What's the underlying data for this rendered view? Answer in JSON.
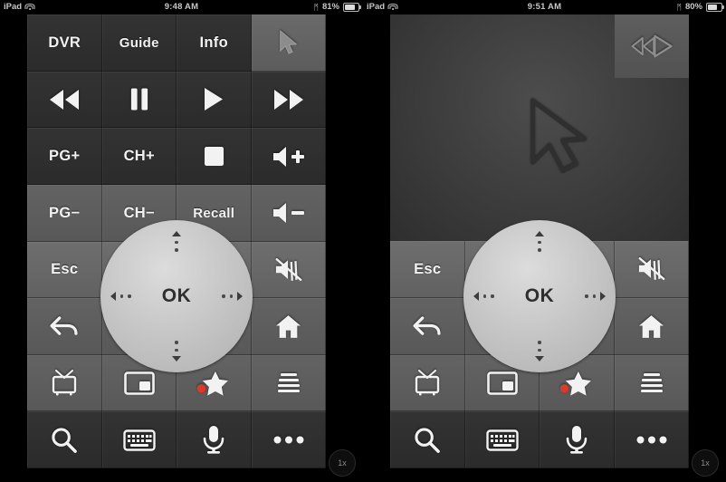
{
  "devices": [
    {
      "id": "left",
      "statusbar": {
        "device": "iPad",
        "wifi_icon": "wifi-icon",
        "time": "9:48 AM",
        "bluetooth_icon": "bluetooth-icon",
        "battery_pct": "81%",
        "battery_icon": "battery-icon",
        "battery_level": 81
      },
      "view": "buttons",
      "zoom_badge": "1x",
      "rows": [
        {
          "keys": [
            {
              "name": "dvr-button",
              "label": "DVR",
              "style": "dark",
              "type": "text"
            },
            {
              "name": "guide-button",
              "label": "Guide",
              "style": "dark",
              "type": "text"
            },
            {
              "name": "info-button",
              "label": "Info",
              "style": "dark",
              "type": "text"
            },
            {
              "name": "cursor-mode-button",
              "label": "",
              "style": "hl",
              "type": "icon",
              "icon": "cursor-arrow-icon"
            }
          ]
        },
        {
          "keys": [
            {
              "name": "rewind-button",
              "label": "",
              "style": "dark",
              "type": "icon",
              "icon": "rewind-icon"
            },
            {
              "name": "pause-button",
              "label": "",
              "style": "dark",
              "type": "icon",
              "icon": "pause-icon"
            },
            {
              "name": "play-button",
              "label": "",
              "style": "dark",
              "type": "icon",
              "icon": "play-icon"
            },
            {
              "name": "fast-forward-button",
              "label": "",
              "style": "dark",
              "type": "icon",
              "icon": "fast-forward-icon"
            }
          ]
        },
        {
          "keys": [
            {
              "name": "page-up-button",
              "label": "PG+",
              "style": "dark",
              "type": "text"
            },
            {
              "name": "channel-up-button",
              "label": "CH+",
              "style": "dark",
              "type": "text"
            },
            {
              "name": "stop-button",
              "label": "",
              "style": "dark",
              "type": "icon",
              "icon": "stop-icon"
            },
            {
              "name": "volume-up-button",
              "label": "",
              "style": "dark",
              "type": "icon",
              "icon": "volume-up-icon"
            }
          ]
        },
        {
          "keys": [
            {
              "name": "page-down-button",
              "label": "PG−",
              "style": "mid",
              "type": "text"
            },
            {
              "name": "channel-down-button",
              "label": "CH−",
              "style": "mid",
              "type": "text"
            },
            {
              "name": "recall-button",
              "label": "Recall",
              "style": "mid",
              "type": "text"
            },
            {
              "name": "volume-down-button",
              "label": "",
              "style": "mid",
              "type": "icon",
              "icon": "volume-down-icon"
            }
          ]
        },
        {
          "keys": [
            {
              "name": "esc-button",
              "label": "Esc",
              "style": "lighter",
              "type": "text"
            },
            {
              "name": "dpad-spacer-a",
              "label": "",
              "style": "lighter",
              "type": "none"
            },
            {
              "name": "dpad-spacer-b",
              "label": "",
              "style": "lighter",
              "type": "none"
            },
            {
              "name": "mute-button",
              "label": "",
              "style": "lighter",
              "type": "icon",
              "icon": "mute-icon"
            }
          ]
        },
        {
          "keys": [
            {
              "name": "back-button",
              "label": "",
              "style": "mid",
              "type": "icon",
              "icon": "back-arrow-icon"
            },
            {
              "name": "dpad-spacer-c",
              "label": "",
              "style": "mid",
              "type": "none"
            },
            {
              "name": "dpad-spacer-d",
              "label": "",
              "style": "mid",
              "type": "none"
            },
            {
              "name": "home-button",
              "label": "",
              "style": "mid",
              "type": "icon",
              "icon": "home-icon"
            }
          ]
        },
        {
          "keys": [
            {
              "name": "live-tv-button",
              "label": "",
              "style": "mid",
              "type": "icon",
              "icon": "tv-icon"
            },
            {
              "name": "picture-in-picture-button",
              "label": "",
              "style": "mid",
              "type": "icon",
              "icon": "pip-icon"
            },
            {
              "name": "record-favorite-button",
              "label": "",
              "style": "mid",
              "type": "icon",
              "icon": "star-record-icon"
            },
            {
              "name": "list-menu-button",
              "label": "",
              "style": "mid",
              "type": "icon",
              "icon": "list-icon"
            }
          ]
        },
        {
          "keys": [
            {
              "name": "search-button",
              "label": "",
              "style": "dark",
              "type": "icon",
              "icon": "search-icon"
            },
            {
              "name": "keyboard-button",
              "label": "",
              "style": "dark",
              "type": "icon",
              "icon": "keyboard-icon"
            },
            {
              "name": "microphone-button",
              "label": "",
              "style": "dark",
              "type": "icon",
              "icon": "microphone-icon"
            },
            {
              "name": "more-options-button",
              "label": "",
              "style": "dark",
              "type": "icon",
              "icon": "ellipsis-icon"
            }
          ]
        }
      ],
      "dpad": {
        "ok_label": "OK",
        "up": "dpad-up",
        "down": "dpad-down",
        "left": "dpad-left",
        "right": "dpad-right"
      }
    },
    {
      "id": "right",
      "statusbar": {
        "device": "iPad",
        "wifi_icon": "wifi-icon",
        "time": "9:51 AM",
        "bluetooth_icon": "bluetooth-icon",
        "battery_pct": "80%",
        "battery_icon": "battery-icon",
        "battery_level": 80
      },
      "view": "trackpad",
      "zoom_badge": "1x",
      "trackpad": {
        "mode_button_icon": "skip-back-play-icon",
        "cursor_icon": "cursor-arrow-outline-icon"
      },
      "rows": [
        {
          "keys": [
            {
              "name": "esc-button",
              "label": "Esc",
              "style": "lighter",
              "type": "text"
            },
            {
              "name": "dpad-spacer-a",
              "label": "",
              "style": "lighter",
              "type": "none"
            },
            {
              "name": "dpad-spacer-b",
              "label": "",
              "style": "lighter",
              "type": "none"
            },
            {
              "name": "mute-button",
              "label": "",
              "style": "lighter",
              "type": "icon",
              "icon": "mute-icon"
            }
          ]
        },
        {
          "keys": [
            {
              "name": "back-button",
              "label": "",
              "style": "mid",
              "type": "icon",
              "icon": "back-arrow-icon"
            },
            {
              "name": "dpad-spacer-c",
              "label": "",
              "style": "mid",
              "type": "none"
            },
            {
              "name": "dpad-spacer-d",
              "label": "",
              "style": "mid",
              "type": "none"
            },
            {
              "name": "home-button",
              "label": "",
              "style": "mid",
              "type": "icon",
              "icon": "home-icon"
            }
          ]
        },
        {
          "keys": [
            {
              "name": "live-tv-button",
              "label": "",
              "style": "mid",
              "type": "icon",
              "icon": "tv-icon"
            },
            {
              "name": "picture-in-picture-button",
              "label": "",
              "style": "mid",
              "type": "icon",
              "icon": "pip-icon"
            },
            {
              "name": "record-favorite-button",
              "label": "",
              "style": "mid",
              "type": "icon",
              "icon": "star-record-icon"
            },
            {
              "name": "list-menu-button",
              "label": "",
              "style": "mid",
              "type": "icon",
              "icon": "list-icon"
            }
          ]
        },
        {
          "keys": [
            {
              "name": "search-button",
              "label": "",
              "style": "dark",
              "type": "icon",
              "icon": "search-icon"
            },
            {
              "name": "keyboard-button",
              "label": "",
              "style": "dark",
              "type": "icon",
              "icon": "keyboard-icon"
            },
            {
              "name": "microphone-button",
              "label": "",
              "style": "dark",
              "type": "icon",
              "icon": "microphone-icon"
            },
            {
              "name": "more-options-button",
              "label": "",
              "style": "dark",
              "type": "icon",
              "icon": "ellipsis-icon"
            }
          ]
        }
      ],
      "dpad": {
        "ok_label": "OK",
        "up": "dpad-up",
        "down": "dpad-down",
        "left": "dpad-left",
        "right": "dpad-right"
      }
    }
  ],
  "colors": {
    "background": "#000000",
    "key_dark": "#333333",
    "key_mid": "#5e5e5e",
    "key_highlight": "#6a6a6a",
    "label": "#f2f2f2",
    "dpad": "#c6c6c6",
    "record_dot": "#d93a2b"
  }
}
